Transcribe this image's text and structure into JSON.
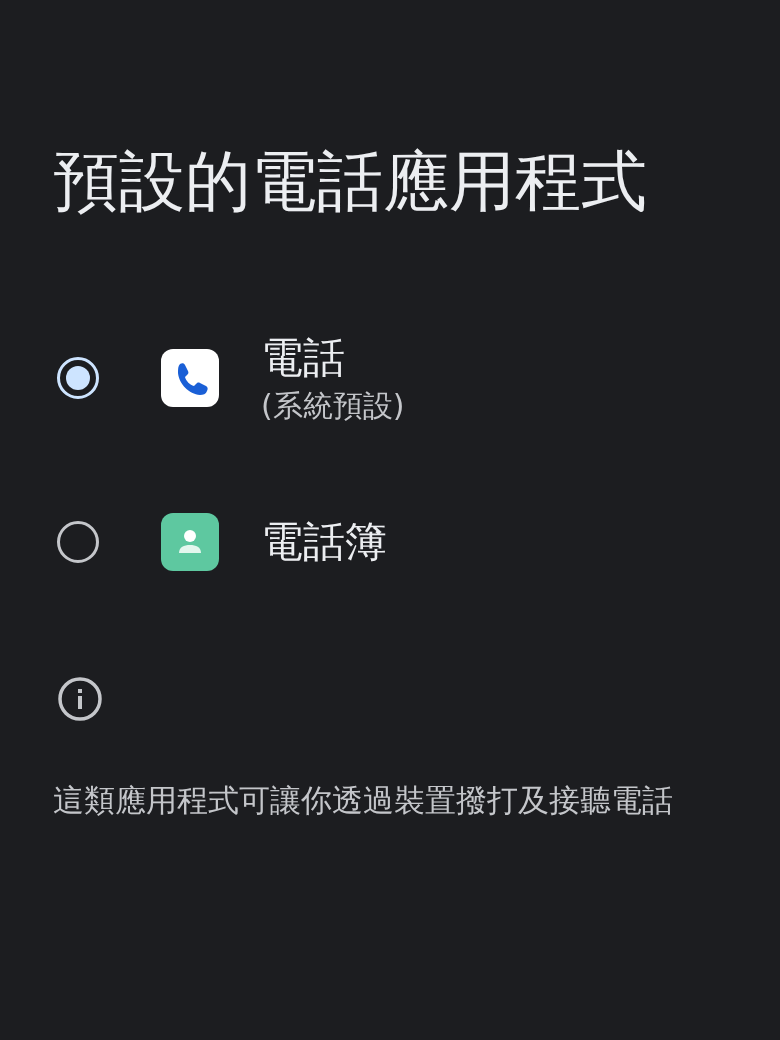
{
  "title": "預設的電話應用程式",
  "apps": [
    {
      "kind": "phone",
      "name": "電話",
      "note": "(系統預設)",
      "selected": true
    },
    {
      "kind": "contacts",
      "name": "電話簿",
      "selected": false
    }
  ],
  "description": "這類應用程式可讓你透過裝置撥打及接聽電話"
}
